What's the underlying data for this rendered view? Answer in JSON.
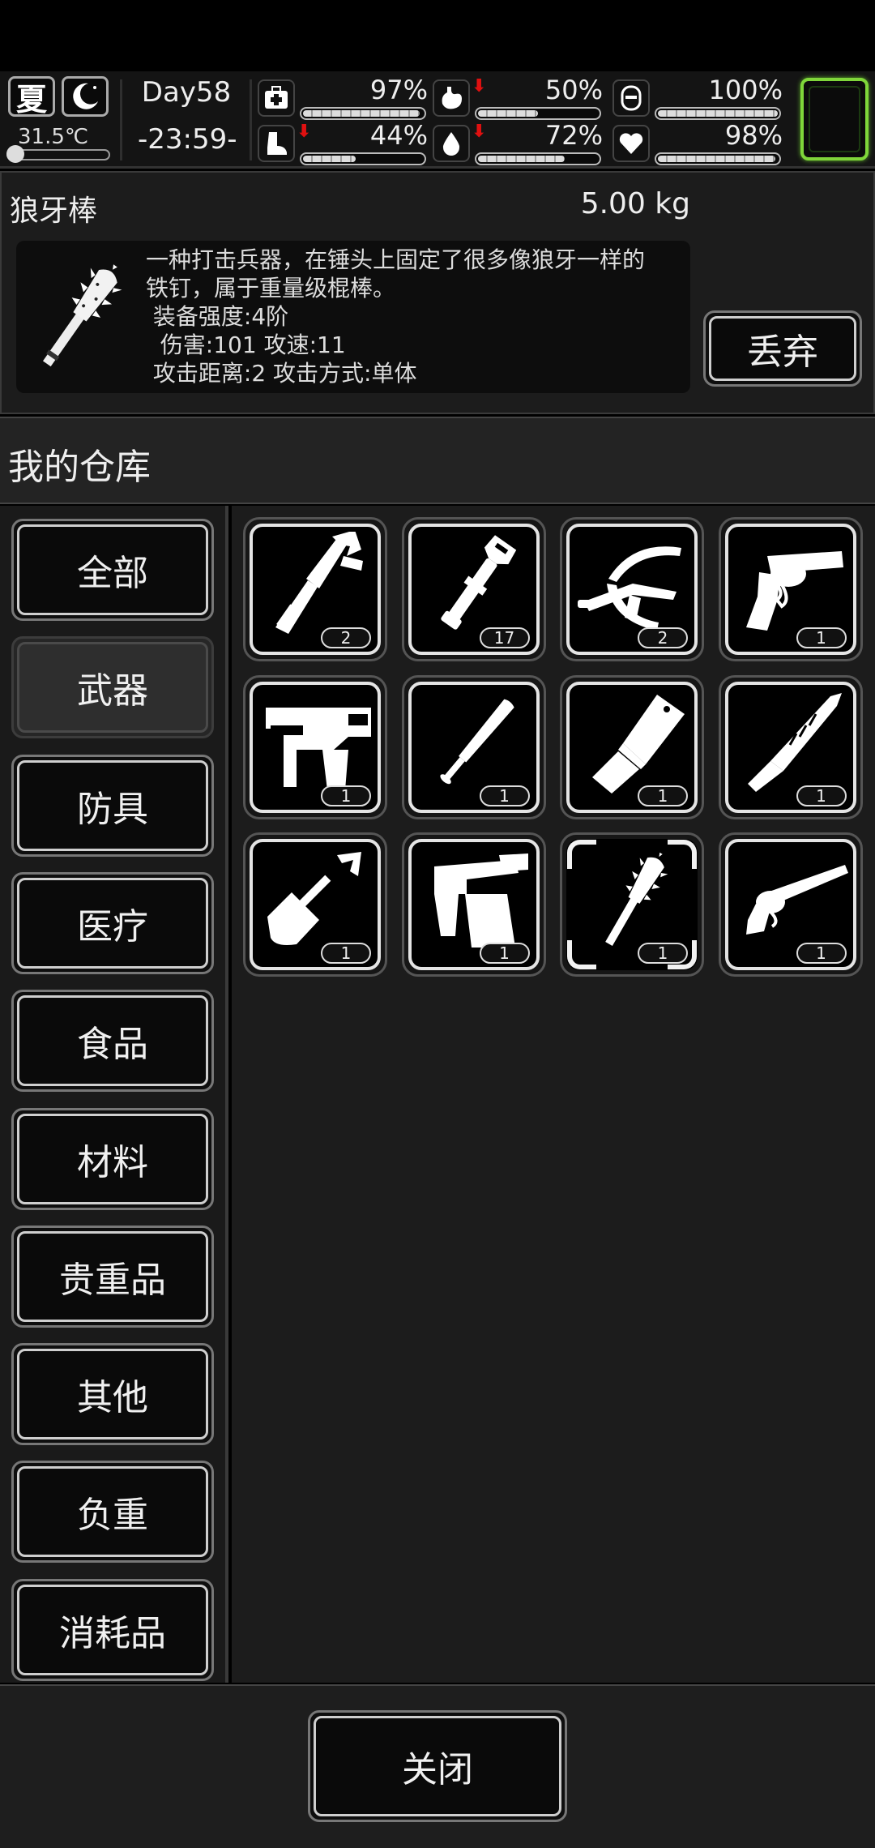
{
  "status": {
    "season": "夏",
    "night_icon": "moon-icon",
    "temperature": "31.5℃",
    "temperature_level": 0.12,
    "day": "Day58",
    "time": "-23:59-",
    "stats": [
      {
        "key": "health",
        "icon": "first-aid-icon",
        "value": "97%",
        "level": 0.97,
        "falling": false
      },
      {
        "key": "hunger",
        "icon": "stomach-icon",
        "value": "50%",
        "level": 0.5,
        "falling": true
      },
      {
        "key": "mood",
        "icon": "face-icon",
        "value": "100%",
        "level": 1.0,
        "falling": false
      },
      {
        "key": "stamina",
        "icon": "boot-icon",
        "value": "44%",
        "level": 0.44,
        "falling": true
      },
      {
        "key": "thirst",
        "icon": "water-drop-icon",
        "value": "72%",
        "level": 0.72,
        "falling": true
      },
      {
        "key": "heart",
        "icon": "heart-icon",
        "value": "98%",
        "level": 0.98,
        "falling": false
      }
    ],
    "equip_highlight_color": "#7fd63a"
  },
  "detail": {
    "name": "狼牙棒",
    "weight": "5.00 kg",
    "icon": "spiked-club-icon",
    "description": "一种打击兵器，在锤头上固定了很多像狼牙一样的\n铁钉，属于重量级棍棒。\n 装备强度:4阶\n  伤害:101 攻速:11\n 攻击距离:2 攻击方式:单体",
    "drop_label": "丢弃"
  },
  "warehouse": {
    "title": "我的仓库"
  },
  "categories": [
    {
      "label": "全部",
      "selected": false
    },
    {
      "label": "武器",
      "selected": true
    },
    {
      "label": "防具",
      "selected": false
    },
    {
      "label": "医疗",
      "selected": false
    },
    {
      "label": "食品",
      "selected": false
    },
    {
      "label": "材料",
      "selected": false
    },
    {
      "label": "贵重品",
      "selected": false
    },
    {
      "label": "其他",
      "selected": false
    },
    {
      "label": "负重",
      "selected": false
    },
    {
      "label": "消耗品",
      "selected": false
    }
  ],
  "items": [
    {
      "icon": "wrench-knife-icon",
      "count": "2",
      "selected": false
    },
    {
      "icon": "pipe-wrench-icon",
      "count": "17",
      "selected": false
    },
    {
      "icon": "crossbow-icon",
      "count": "2",
      "selected": false
    },
    {
      "icon": "revolver-icon",
      "count": "1",
      "selected": false
    },
    {
      "icon": "nail-gun-icon",
      "count": "1",
      "selected": false
    },
    {
      "icon": "baseball-bat-icon",
      "count": "1",
      "selected": false
    },
    {
      "icon": "cleaver-icon",
      "count": "1",
      "selected": false
    },
    {
      "icon": "machete-icon",
      "count": "1",
      "selected": false
    },
    {
      "icon": "shovel-icon",
      "count": "1",
      "selected": false
    },
    {
      "icon": "blowtorch-icon",
      "count": "1",
      "selected": false
    },
    {
      "icon": "spiked-club-icon",
      "count": "1",
      "selected": true
    },
    {
      "icon": "old-revolver-icon",
      "count": "1",
      "selected": false
    }
  ],
  "footer": {
    "close_label": "关闭"
  }
}
